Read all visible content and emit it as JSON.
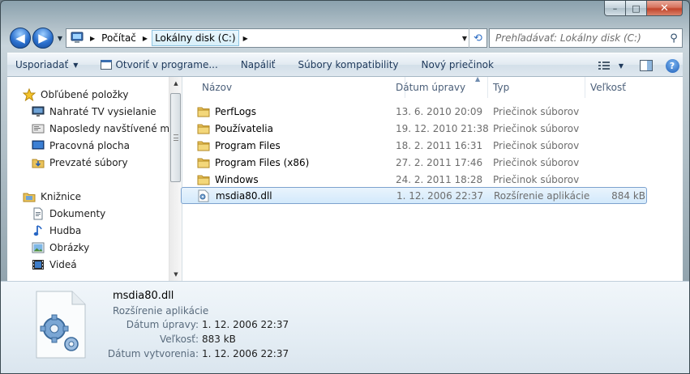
{
  "window": {
    "caption": {
      "minimize": "–",
      "maximize": "□",
      "close": "✕"
    }
  },
  "nav": {
    "back_label": "◀",
    "forward_label": "▶",
    "recent_caret": "▼",
    "breadcrumbs": [
      "Počítač",
      "Lokálny disk (C:)"
    ],
    "refresh_icon": "refresh-icon",
    "search_placeholder": "Prehľadávať: Lokálny disk (C:)"
  },
  "toolbar": {
    "organize": "Usporiadať",
    "open_with": "Otvoriť v programe...",
    "burn": "Napáliť",
    "compat": "Súbory kompatibility",
    "new_folder": "Nový priečinok",
    "help": "?"
  },
  "sidebar": {
    "favorites": {
      "label": "Obľúbené položky",
      "items": [
        "Nahraté TV vysielanie",
        "Naposledy navštívené miesta",
        "Pracovná plocha",
        "Prevzaté súbory"
      ]
    },
    "libraries": {
      "label": "Knižnice",
      "items": [
        "Dokumenty",
        "Hudba",
        "Obrázky",
        "Videá"
      ]
    }
  },
  "columns": {
    "name": "Názov",
    "date": "Dátum úpravy",
    "type": "Typ",
    "size": "Veľkosť"
  },
  "files": [
    {
      "name": "PerfLogs",
      "date": "13. 6. 2010 20:09",
      "type": "Priečinok súborov",
      "size": "",
      "icon": "folder-icon"
    },
    {
      "name": "Používatelia",
      "date": "19. 12. 2010 21:38",
      "type": "Priečinok súborov",
      "size": "",
      "icon": "folder-icon"
    },
    {
      "name": "Program Files",
      "date": "18. 2. 2011 16:31",
      "type": "Priečinok súborov",
      "size": "",
      "icon": "folder-icon"
    },
    {
      "name": "Program Files (x86)",
      "date": "27. 2. 2011 17:46",
      "type": "Priečinok súborov",
      "size": "",
      "icon": "folder-icon"
    },
    {
      "name": "Windows",
      "date": "24. 2. 2011 18:28",
      "type": "Priečinok súborov",
      "size": "",
      "icon": "folder-icon"
    },
    {
      "name": "msdia80.dll",
      "date": "1. 12. 2006 22:37",
      "type": "Rozšírenie aplikácie",
      "size": "884 kB",
      "icon": "dll-file-icon",
      "selected": true
    }
  ],
  "details": {
    "name": "msdia80.dll",
    "type": "Rozšírenie aplikácie",
    "modified_label": "Dátum úpravy:",
    "modified": "1. 12. 2006 22:37",
    "size_label": "Veľkosť:",
    "size": "883 kB",
    "created_label": "Dátum vytvorenia:",
    "created": "1. 12. 2006 22:37"
  }
}
